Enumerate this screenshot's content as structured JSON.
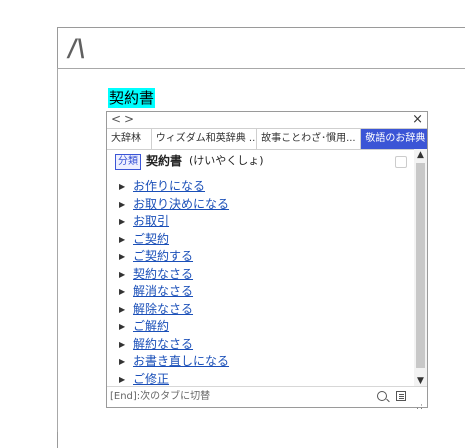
{
  "document": {
    "logo": "/\\"
  },
  "selection": {
    "text": "契約書"
  },
  "popup": {
    "nav_prev": "<",
    "nav_next": ">",
    "close": "×",
    "tabs": [
      "大辞林",
      "ウィズダム和英辞典 ...",
      "故事ことわざ･慣用...",
      "敬語のお辞典"
    ],
    "active_tab_index": 3,
    "entry": {
      "category": "分類",
      "word": "契約書",
      "reading": "(けいやくしょ)"
    },
    "items": [
      "お作りになる",
      "お取り決めになる",
      "お取引",
      "ご契約",
      "ご契約する",
      "契約なさる",
      "解消なさる",
      "解除なさる",
      "ご解約",
      "解約なさる",
      "お書き直しになる",
      "ご修正"
    ],
    "footer": "[End]:次のタブに切替"
  },
  "colors": {
    "selection_bg": "#00ffff",
    "active_tab_bg": "#3b55d6",
    "link": "#1a4fb8"
  }
}
